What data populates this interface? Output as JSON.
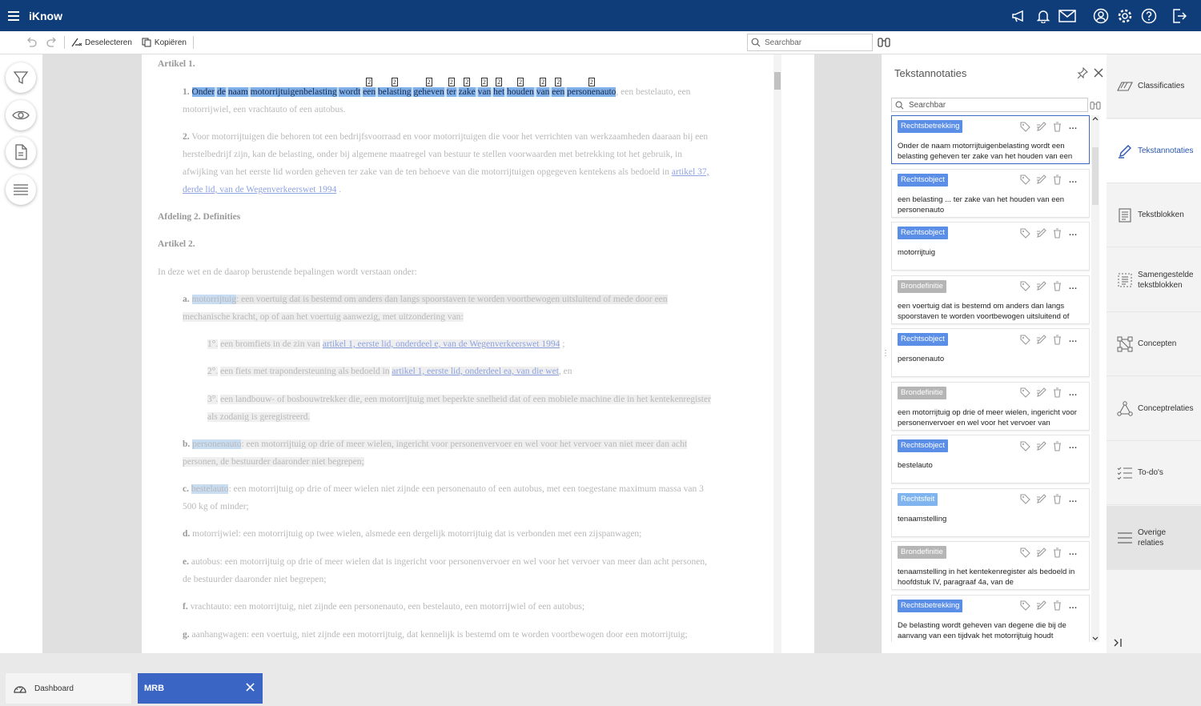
{
  "app": {
    "title": "iKnow"
  },
  "toolbar": {
    "deselect": "Deselecteren",
    "copy": "Kopiëren",
    "search_placeholder": "Searchbar"
  },
  "document": {
    "art1": "Artikel 1.",
    "p1_num": "1.",
    "p1_words": [
      "Onder",
      "de",
      "naam",
      "motorrijtuigenbelasting",
      "wordt",
      "een",
      "belasting",
      "geheven",
      "ter",
      "zake",
      "van",
      "het",
      "houden",
      "van",
      "een",
      "personenauto"
    ],
    "p1_tail": ", een bestelauto, een",
    "p1_l2": "motorrijwiel, een vrachtauto of een autobus.",
    "p2_num": "2.",
    "p2_l1": "Voor motorrijtuigen die behoren tot een bedrijfsvoorraad en voor motorrijtuigen die voor het verrichten van werkzaamheden daaraan bij een",
    "p2_l2": "herstelbedrijf zijn, kan de belasting, onder bij algemene maatregel van bestuur te stellen voorwaarden met betrekking tot het gebruik, in",
    "p2_l3": "afwijking van het eerste lid worden geheven ter zake van de ten behoeve van die motorrijtuigen opgegeven kentekens als bedoeld in",
    "p2_link1": "artikel 37,",
    "p2_link2": "derde lid, van de Wegenverkeerswet 1994",
    "p2_end": ".",
    "afd2": "Afdeling 2. Definities",
    "art2": "Artikel 2.",
    "intro": "In deze wet en de daarop berustende bepalingen wordt verstaan onder:",
    "a_lbl": "a.",
    "a_term": "motorrijtuig",
    "a_l1": ": een voertuig dat is bestemd om anders dan langs spoorstaven te worden voortbewogen uitsluitend of mede door een",
    "a_l2": "mechanische kracht, op of aan het voertuig aanwezig, met uitzondering van:",
    "s1_lbl": "1°.",
    "s1_txt": "een bromfiets in de zin van",
    "s1_link": "artikel 1, eerste lid, onderdeel e, van de Wegenverkeerswet 1994",
    "s1_end": ";",
    "s2_lbl": "2°.",
    "s2_txt": "een fiets met trapondersteuning als bedoeld in",
    "s2_link": "artikel 1, eerste lid, onderdeel ea, van die wet",
    "s2_end": ", en",
    "s3_lbl": "3°.",
    "s3_l1": "een landbouw- of bosbouwtrekker die, een motorrijtuig met beperkte snelheid dat of een mobiele machine die in het kentekenregister",
    "s3_l2": "als zodanig is geregistreerd.",
    "b_lbl": "b.",
    "b_term": "personenauto",
    "b_l1": ": een motorrijtuig op drie of meer wielen, ingericht voor personenvervoer en wel voor het vervoer van niet meer dan acht",
    "b_l2": "personen, de bestuurder daaronder niet begrepen;",
    "c_lbl": "c.",
    "c_term": "bestelauto",
    "c_l1": ": een motorrijtuig op drie of meer wielen niet zijnde een personenauto of een autobus, met een toegestane maximum massa van 3",
    "c_l2": "500 kg of minder;",
    "d_lbl": "d.",
    "d_l1": "motorrijwiel: een motorrijtuig op twee wielen, alsmede een dergelijk motorrijtuig dat is verbonden met een zijspanwagen;",
    "e_lbl": "e.",
    "e_l1": "autobus: een motorrijtuig op drie of meer wielen dat is ingericht voor personenvervoer en wel voor het vervoer van meer dan acht personen,",
    "e_l2": "de bestuurder daaronder niet begrepen;",
    "f_lbl": "f.",
    "f_l1": "vrachtauto: een motorrijtuig, niet zijnde een personenauto, een bestelauto, een motorrijwiel of een autobus;",
    "g_lbl": "g.",
    "g_l1": "aanhangwagen: een voertuig, niet zijnde een motorrijtuig, dat kennelijk is bestemd om te worden voortbewogen door een motorrijtuig;",
    "sup": "2"
  },
  "panel": {
    "title": "Tekstannotaties",
    "search_placeholder": "Searchbar",
    "cards": [
      {
        "label": "Rechtsbetrekking",
        "color": "#5b8ee6",
        "text": "Onder de naam motorrijtuigenbelasting wordt een belasting geheven ter zake van het houden van een"
      },
      {
        "label": "Rechtsobject",
        "color": "#5b8ee6",
        "text": "een belasting ... ter zake van het houden van een personenauto"
      },
      {
        "label": "Rechtsobject",
        "color": "#5b8ee6",
        "text": "motorrijtuig"
      },
      {
        "label": "Brondefinitie",
        "color": "#b5b5b5",
        "text": "een voertuig dat is bestemd om anders dan langs spoorstaven te worden voortbewogen uitsluitend of"
      },
      {
        "label": "Rechtsobject",
        "color": "#5b8ee6",
        "text": "personenauto"
      },
      {
        "label": "Brondefinitie",
        "color": "#b5b5b5",
        "text": "een motorrijtuig op drie of meer wielen, ingericht voor personenvervoer en wel voor het vervoer van"
      },
      {
        "label": "Rechtsobject",
        "color": "#5b8ee6",
        "text": "bestelauto"
      },
      {
        "label": "Rechtsfeit",
        "color": "#7fb4ee",
        "text": "tenaamstelling"
      },
      {
        "label": "Brondefinitie",
        "color": "#b5b5b5",
        "text": "tenaamstelling in het kentekenregister als bedoeld in hoofdstuk IV, paragraaf 4a, van de"
      },
      {
        "label": "Rechtsbetrekking",
        "color": "#5b8ee6",
        "text": "De belasting wordt geheven van degene die bij de aanvang van een tijdvak het motorrijtuig houdt"
      }
    ]
  },
  "rnav": {
    "items": [
      {
        "label": "Classificaties"
      },
      {
        "label": "Tekstannotaties"
      },
      {
        "label": "Tekstblokken"
      },
      {
        "label1": "Samengestelde",
        "label2": "tekstblokken"
      },
      {
        "label": "Concepten"
      },
      {
        "label": "Conceptrelaties"
      },
      {
        "label": "To-do's"
      },
      {
        "label1": "Overige",
        "label2": "relaties"
      }
    ]
  },
  "bottom": {
    "dashboard": "Dashboard",
    "mrb": "MRB"
  },
  "colors": {
    "header": "#0e3d7a",
    "tab_active": "#3a65c4",
    "highlight": "#7fb0ea"
  }
}
